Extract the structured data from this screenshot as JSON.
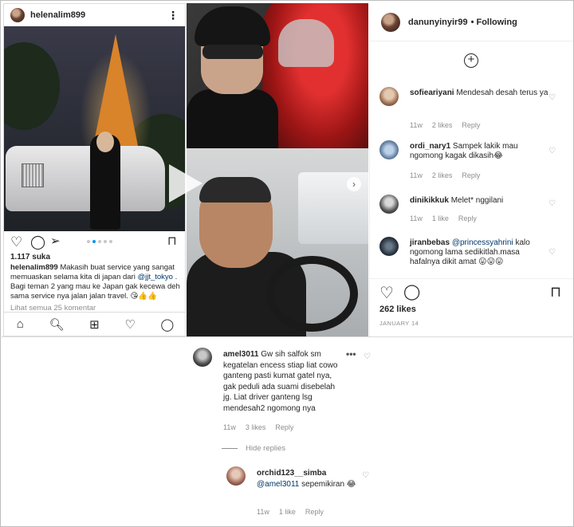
{
  "left_post": {
    "username": "helenalim899",
    "likes": "1.117 suka",
    "caption_user": "helenalim899",
    "caption_text": "Makasih buat service yang sangat memuaskan selama kita di japan dari ",
    "caption_mention": "@jjt_tokyo",
    "caption_text2": " . Bagi teman 2 yang mau ke Japan gak kecewa deh sama service nya jalan jalan travel. 😘👍👍",
    "view_all": "Lihat semua 25 komentar",
    "carousel_active_index": 1
  },
  "right_post": {
    "username": "danunyinyir99",
    "follow_status": "• Following",
    "likes": "262 likes",
    "date": "JANUARY 14",
    "comments": [
      {
        "user": "sofieariyani",
        "text": "Mendesah desah terus ya",
        "time": "11w",
        "likes": "2 likes",
        "reply": "Reply"
      },
      {
        "user": "ordi_nary1",
        "text": "Sampek lakik mau ngomong kagak dikasih😂",
        "time": "11w",
        "likes": "2 likes",
        "reply": "Reply"
      },
      {
        "user": "dinikikkuk",
        "text": "Melet* nggilani",
        "time": "11w",
        "likes": "1 like",
        "reply": "Reply"
      },
      {
        "user": "jiranbebas",
        "mention": "@princessyahrini",
        "text": " kalo ngomong lama sedikitlah.masa hafalnya dikit amat 😛😛😛"
      }
    ]
  },
  "thread": {
    "main": {
      "user": "amel3011",
      "text": "Gw sih salfok sm kegatelan encess stiap liat cowo ganteng pasti kumat gatel nya, gak peduli ada suami disebelah jg. Liat driver ganteng lsg mendesah2 ngomong nya",
      "time": "11w",
      "likes": "3 likes",
      "reply": "Reply"
    },
    "hide_replies": "Hide replies",
    "reply": {
      "user": "orchid123__simba",
      "mention": "@amel3011",
      "text": " sepemikiran 😂",
      "time": "11w",
      "likes": "1 like",
      "reply": "Reply"
    }
  }
}
